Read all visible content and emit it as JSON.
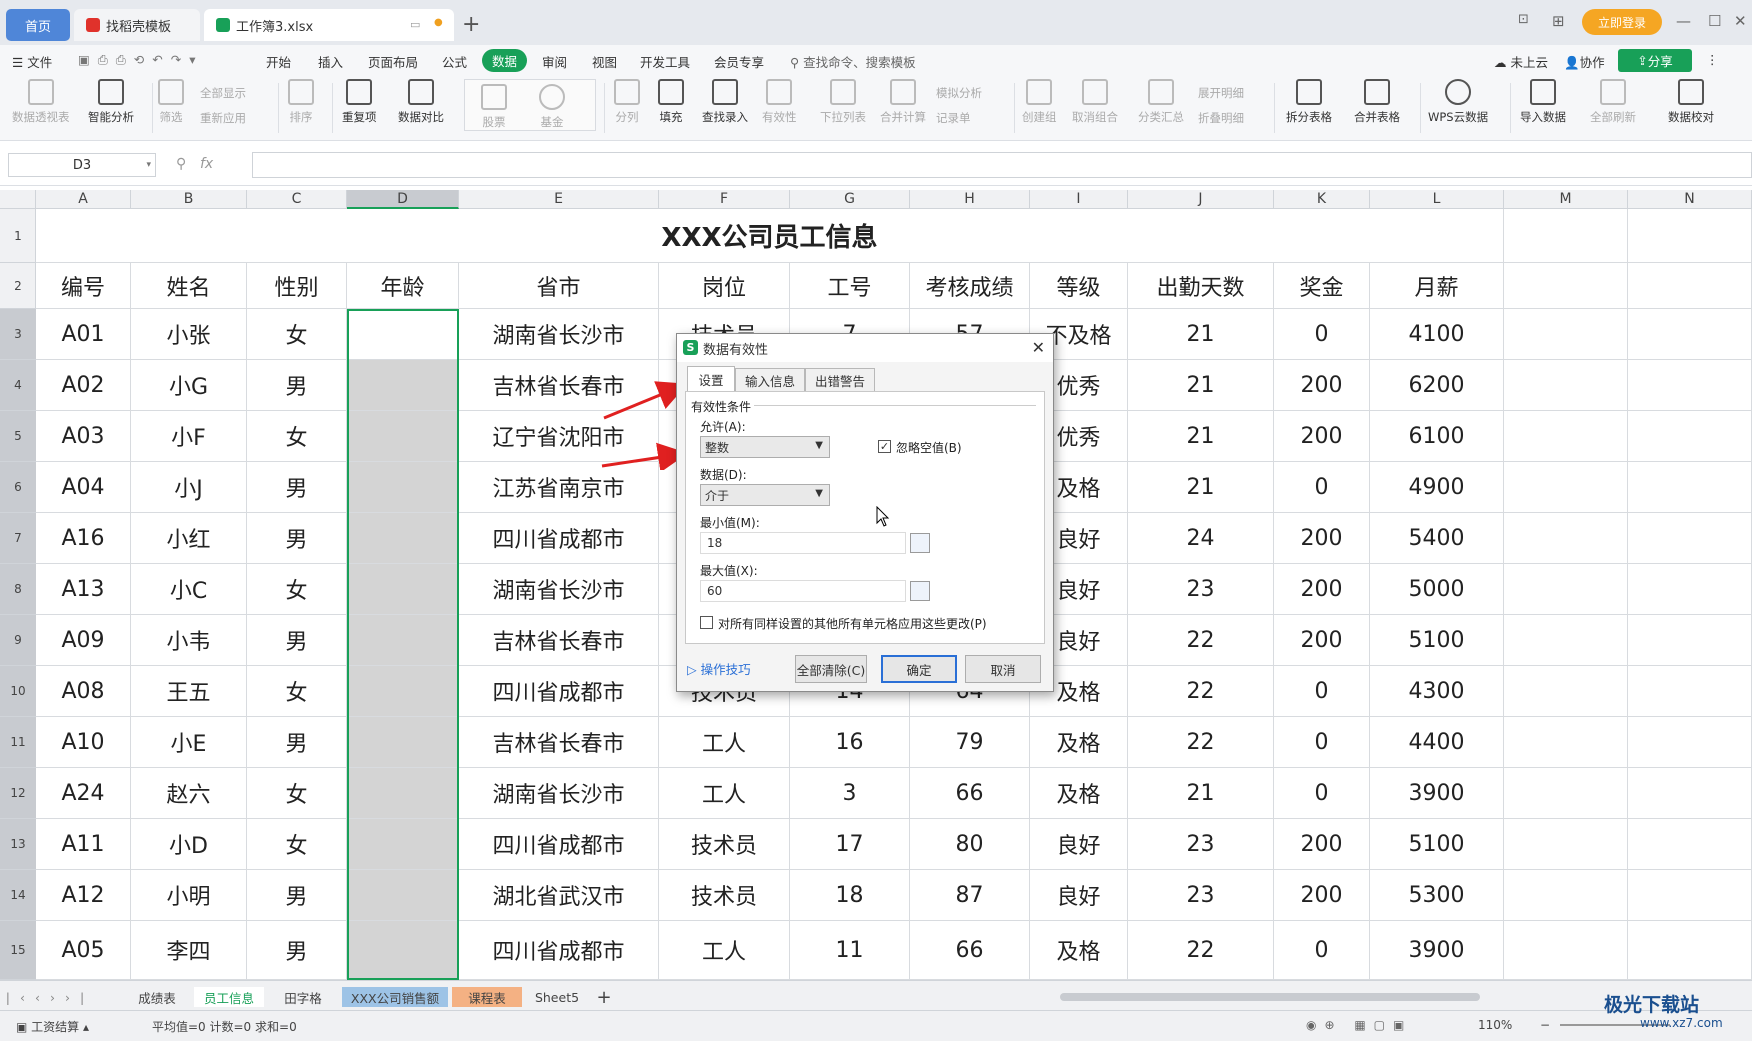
{
  "tabs": [
    {
      "label": "首页"
    },
    {
      "label": "找稻壳模板"
    },
    {
      "label": "工作簿3.xlsx"
    }
  ],
  "login_label": "立即登录",
  "menu": {
    "file": "文件",
    "items": [
      "开始",
      "插入",
      "页面布局",
      "公式",
      "数据",
      "审阅",
      "视图",
      "开发工具",
      "会员专享"
    ],
    "search": "查找命令、搜索模板",
    "cloud": "未上云",
    "collab": "协作",
    "share": "分享"
  },
  "ribbon": {
    "pivot": "数据透视表",
    "smart": "智能分析",
    "filter": "筛选",
    "showall": "全部显示",
    "reapply": "重新应用",
    "sort": "排序",
    "dup": "重复项",
    "compare": "数据对比",
    "stock": "股票",
    "fund": "基金",
    "split": "分列",
    "fill": "填充",
    "lookup": "查找录入",
    "validity": "有效性",
    "dropdown": "下拉列表",
    "merge_calc": "合并计算",
    "whatif": "模拟分析",
    "record": "记录单",
    "group": "创建组",
    "ungroup": "取消组合",
    "subtotal": "分类汇总",
    "expand": "展开明细",
    "collapse": "折叠明细",
    "split_table": "拆分表格",
    "merge_table": "合并表格",
    "wps_cloud": "WPS云数据",
    "import": "导入数据",
    "refresh_all": "全部刷新",
    "verify": "数据校对"
  },
  "name_box": "D3",
  "fx_label": "fx",
  "columns": [
    "A",
    "B",
    "C",
    "D",
    "E",
    "F",
    "G",
    "H",
    "I",
    "J",
    "K",
    "L",
    "M",
    "N"
  ],
  "rows": [
    "1",
    "2",
    "3",
    "4",
    "5",
    "6",
    "7",
    "8",
    "9",
    "10",
    "11",
    "12",
    "13",
    "14",
    "15"
  ],
  "sheet_title": "XXX公司员工信息",
  "headers": [
    "编号",
    "姓名",
    "性别",
    "年龄",
    "省市",
    "岗位",
    "工号",
    "考核成绩",
    "等级",
    "出勤天数",
    "奖金",
    "月薪"
  ],
  "table": [
    [
      "A01",
      "小张",
      "女",
      "",
      "湖南省长沙市",
      "技术员",
      "7",
      "57",
      "不及格",
      "21",
      "0",
      "4100"
    ],
    [
      "A02",
      "小G",
      "男",
      "",
      "吉林省长春市",
      "",
      "",
      "",
      "优秀",
      "21",
      "200",
      "6200"
    ],
    [
      "A03",
      "小F",
      "女",
      "",
      "辽宁省沈阳市",
      "",
      "",
      "",
      "优秀",
      "21",
      "200",
      "6100"
    ],
    [
      "A04",
      "小J",
      "男",
      "",
      "江苏省南京市",
      "",
      "",
      "",
      "及格",
      "21",
      "0",
      "4900"
    ],
    [
      "A16",
      "小红",
      "男",
      "",
      "四川省成都市",
      "",
      "",
      "",
      "良好",
      "24",
      "200",
      "5400"
    ],
    [
      "A13",
      "小C",
      "女",
      "",
      "湖南省长沙市",
      "",
      "",
      "",
      "良好",
      "23",
      "200",
      "5000"
    ],
    [
      "A09",
      "小韦",
      "男",
      "",
      "吉林省长春市",
      "",
      "",
      "",
      "良好",
      "22",
      "200",
      "5100"
    ],
    [
      "A08",
      "王五",
      "女",
      "",
      "四川省成都市",
      "技术员",
      "14",
      "64",
      "及格",
      "22",
      "0",
      "4300"
    ],
    [
      "A10",
      "小E",
      "男",
      "",
      "吉林省长春市",
      "工人",
      "16",
      "79",
      "及格",
      "22",
      "0",
      "4400"
    ],
    [
      "A24",
      "赵六",
      "女",
      "",
      "湖南省长沙市",
      "工人",
      "3",
      "66",
      "及格",
      "21",
      "0",
      "3900"
    ],
    [
      "A11",
      "小D",
      "女",
      "",
      "四川省成都市",
      "技术员",
      "17",
      "80",
      "良好",
      "23",
      "200",
      "5100"
    ],
    [
      "A12",
      "小明",
      "男",
      "",
      "湖北省武汉市",
      "技术员",
      "18",
      "87",
      "良好",
      "23",
      "200",
      "5300"
    ],
    [
      "A05",
      "李四",
      "男",
      "",
      "四川省成都市",
      "工人",
      "11",
      "66",
      "及格",
      "22",
      "0",
      "3900"
    ]
  ],
  "sheet_tabs": [
    "成绩表",
    "员工信息",
    "田字格",
    "XXX公司销售额",
    "课程表",
    "Sheet5"
  ],
  "status": {
    "mode": "工资结算",
    "stats": "平均值=0  计数=0  求和=0",
    "zoom": "110%"
  },
  "watermark": "极光下载站",
  "watermark_url": "www.xz7.com",
  "dialog": {
    "title": "数据有效性",
    "tabs": [
      "设置",
      "输入信息",
      "出错警告"
    ],
    "section": "有效性条件",
    "allow_label": "允许(A):",
    "allow_value": "整数",
    "ignore_blank": "忽略空值(B)",
    "data_label": "数据(D):",
    "data_value": "介于",
    "min_label": "最小值(M):",
    "min_value": "18",
    "max_label": "最大值(X):",
    "max_value": "60",
    "apply_all": "对所有同样设置的其他所有单元格应用这些更改(P)",
    "tips": "操作技巧",
    "clear_all": "全部清除(C)",
    "ok": "确定",
    "cancel": "取消"
  }
}
